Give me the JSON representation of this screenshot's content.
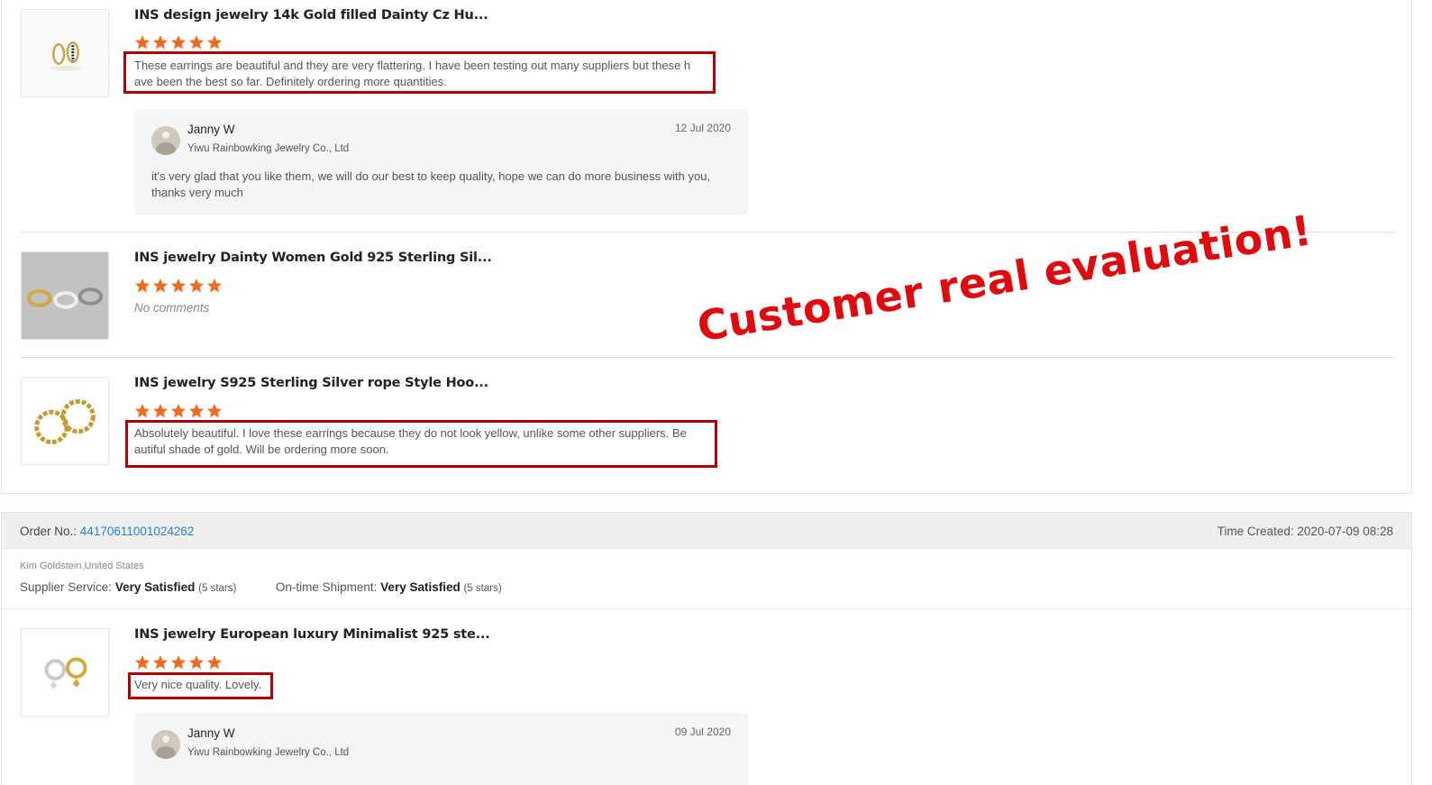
{
  "reviews_top": [
    {
      "title": "INS design jewelry 14k Gold filled Dainty Cz Hu...",
      "stars": 5,
      "comment_line1": "These earrings are beautiful and they are very flattering. I have been testing out many suppliers but these h",
      "comment_line2": "ave been the best so far. Definitely ordering more quantities.",
      "reply": {
        "name": "Janny W",
        "company": "Yiwu Rainbowking Jewelry Co., Ltd",
        "date": "12 Jul 2020",
        "text": "it's very glad that you like them,  we will do our best to keep quality, hope we can do more business with you, thanks very much"
      }
    },
    {
      "title": "INS jewelry Dainty Women Gold 925 Sterling Sil...",
      "stars": 5,
      "no_comment": "No comments"
    },
    {
      "title": "INS jewelry S925 Sterling Silver rope Style Hoo...",
      "stars": 5,
      "comment_line1": "Absolutely beautiful. I love these earrings because they do not look yellow, unlike some other suppliers. Be",
      "comment_line2": "autiful shade of gold. Will be ordering more soon."
    }
  ],
  "order": {
    "order_no_label": "Order No.:",
    "order_no": "44170611001024262",
    "time_created_label": "Time Created:",
    "time_created": "2020-07-09 08:28",
    "buyer": "Kim Goldstein,United States",
    "supplier_service_label": "Supplier Service:",
    "supplier_service_value": "Very Satisfied",
    "supplier_service_stars": "(5 stars)",
    "shipment_label": "On-time Shipment:",
    "shipment_value": "Very Satisfied",
    "shipment_stars": "(5 stars)"
  },
  "review_bottom": {
    "title": "INS jewelry European luxury Minimalist 925 ste...",
    "stars": 5,
    "comment": "Very nice quality. Lovely.",
    "reply": {
      "name": "Janny W",
      "company": "Yiwu Rainbowking Jewelry Co., Ltd",
      "date": "09 Jul 2020"
    }
  },
  "overlay_text": "Customer real evaluation!",
  "colors": {
    "star": "#f06b1e",
    "link": "#2b7fd1",
    "highlight_box": "#b30000",
    "overlay": "#e0090d"
  }
}
